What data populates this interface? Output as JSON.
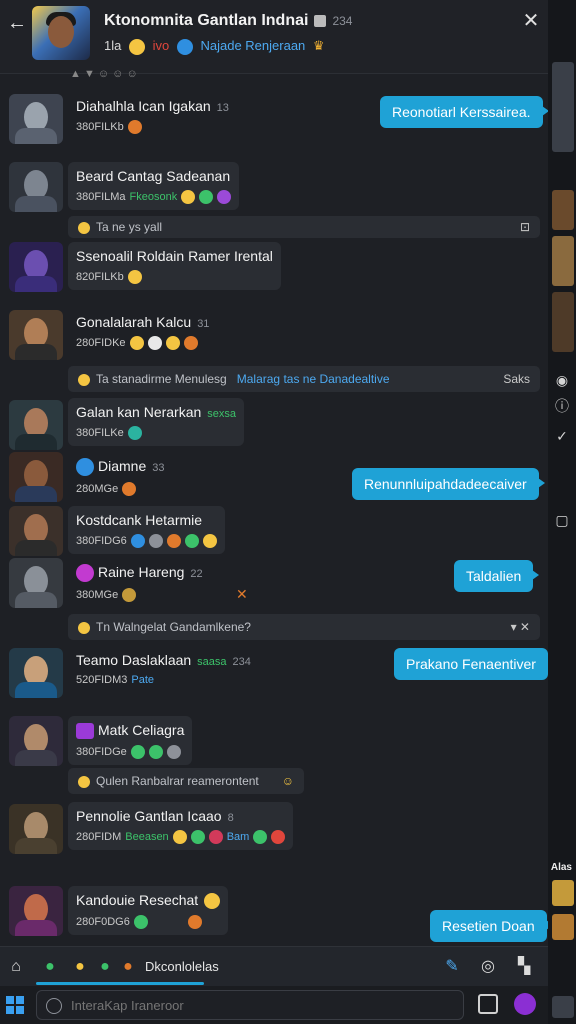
{
  "header": {
    "title": "Ktonomnita Gantlan Indnai",
    "count": "234",
    "members": "1la",
    "status": "ivo",
    "tagline": "Najade Renjeraan"
  },
  "top_strip": "▲ ▼ ☺ ☺ ☺",
  "messages": [
    {
      "name": "Diahalhla Ican Igakan",
      "ts": "13",
      "meta": "380FILKb",
      "out": "Reonotiarl Kerssairea."
    },
    {
      "name": "Beard Cantag Sadeanan",
      "ts": "",
      "meta": "380FILMa",
      "link": "Fkeosonk"
    },
    {
      "name": "Ssenoalil Roldain Ramer Irental",
      "ts": "",
      "meta": "820FILKb"
    },
    {
      "name": "Gonalalarah Kalcu",
      "ts": "31",
      "meta": "280FIDKe"
    },
    {
      "name": "Galan kan Nerarkan",
      "ts": "",
      "meta": "380FILKe",
      "green": "sexsa"
    },
    {
      "name": "Diamne",
      "ts": "33",
      "meta": "280MGe",
      "out": "Renunnluipahdadeecaiver"
    },
    {
      "name": "Kostdcank Hetarmie",
      "ts": "",
      "meta": "380FIDG6"
    },
    {
      "name": "Raine Hareng",
      "ts": "22",
      "meta": "380MGe",
      "out": "Taldalien"
    },
    {
      "name": "Teamo Daslaklaan",
      "ts": "234",
      "meta": "520FIDM3",
      "link": "Pate",
      "green": "saasa",
      "out": "Prakano Fenaentiver"
    },
    {
      "name": "Matk Celiagra",
      "ts": "",
      "meta": "380FIDGe"
    },
    {
      "name": "Pennolie Gantlan Icaao",
      "ts": "8",
      "meta": "280FIDM",
      "green": "Beeasen",
      "link": "Bam"
    },
    {
      "name": "Kandouie Resechat",
      "ts": "",
      "meta": "280F0DG6",
      "out": "Resetien Doan"
    }
  ],
  "system_rows": [
    {
      "text": "Ta ne ys yall",
      "end": "⊡"
    },
    {
      "text": "Ta stanadirme Menulesg",
      "blue": "Malarag tas ne   Danadealtive",
      "end": "Saks"
    },
    {
      "text": "Tn Walngelat Gandamlkene?",
      "end": "▾ ✕"
    },
    {
      "text": "Qulen Ranbalrar reamerontent",
      "end": "☺"
    }
  ],
  "toolbar": {
    "label": "Dkconlolelas"
  },
  "compose": {
    "placeholder": "InteraKap Iraneroor"
  },
  "side_tag": "Alas",
  "colors": {
    "accent": "#1fa2d6",
    "background": "#1e2025",
    "bubble": "#2a2d33"
  }
}
